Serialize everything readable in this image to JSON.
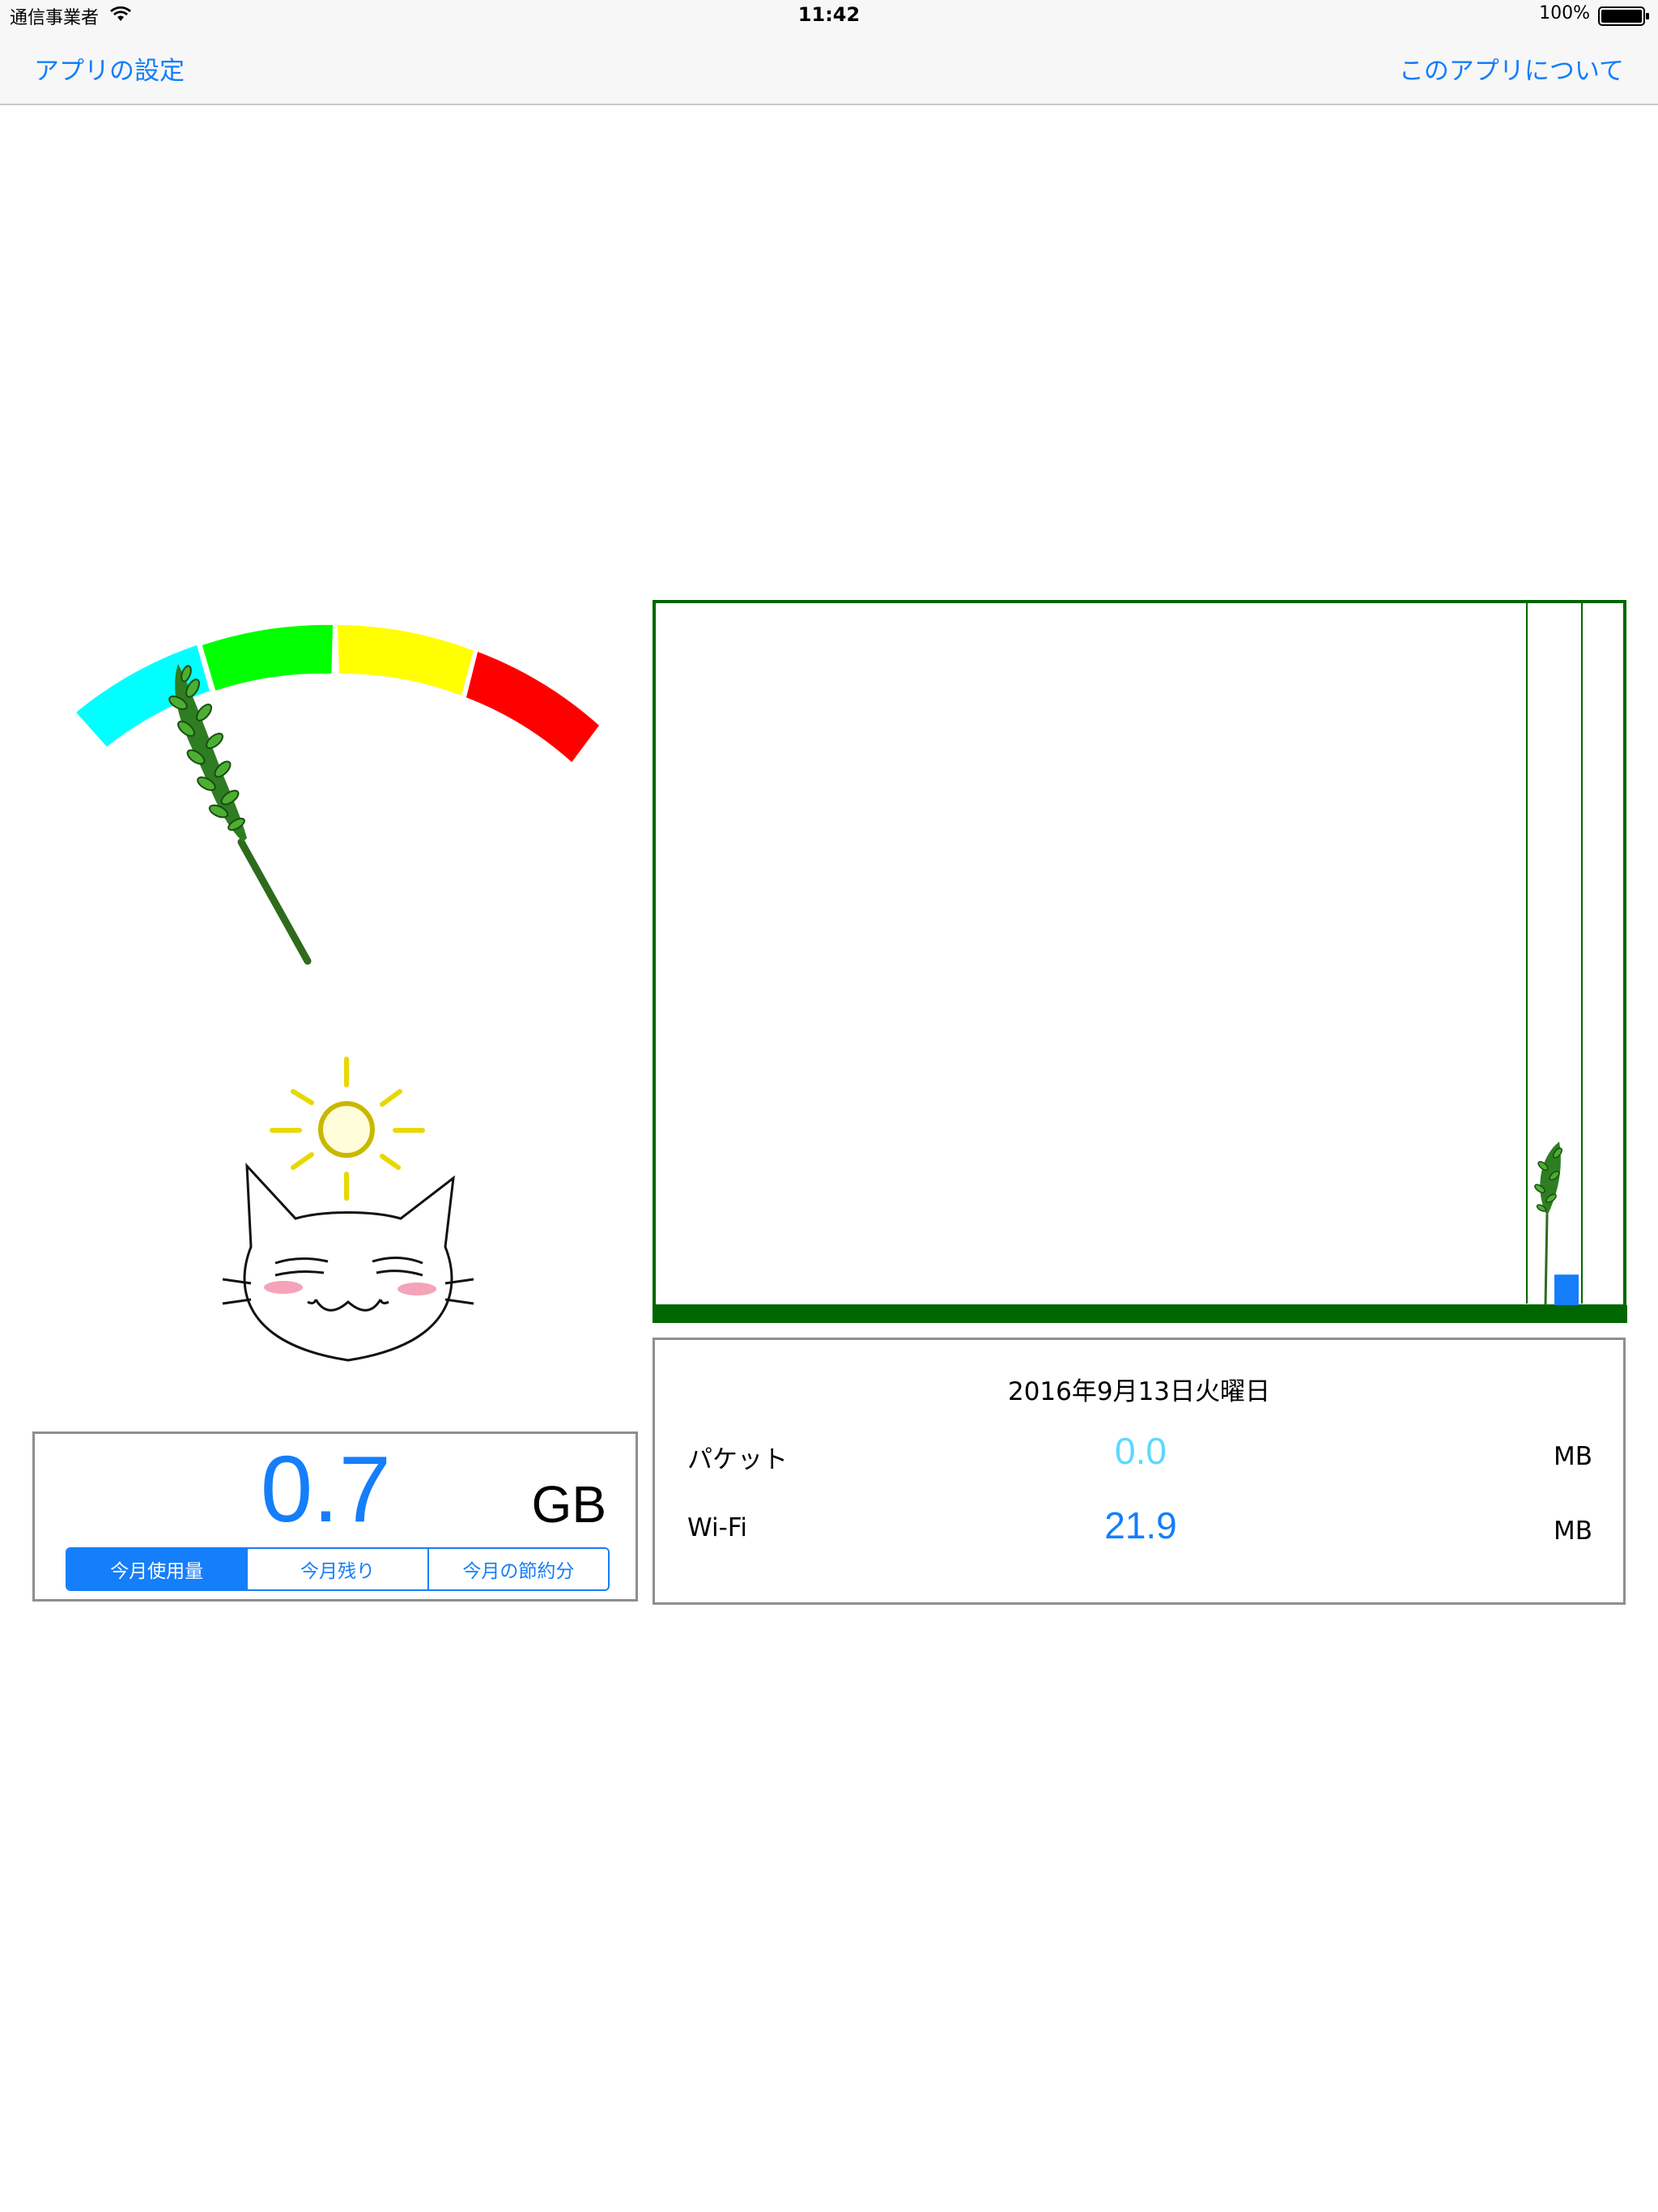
{
  "status_bar": {
    "carrier": "通信事業者",
    "time": "11:42",
    "battery": "100%"
  },
  "nav": {
    "left": "アプリの設定",
    "right": "このアプリについて"
  },
  "usage": {
    "value": "0.7",
    "unit": "GB",
    "segments": [
      "今月使用量",
      "今月残り",
      "今月の節約分"
    ],
    "selected_segment": 0
  },
  "gauge": {
    "bands": [
      "#00ffff",
      "#00ff00",
      "#ffff00",
      "#ff0000"
    ],
    "level": 0.1
  },
  "info": {
    "date": "2016年9月13日火曜日",
    "rows": [
      {
        "label": "パケット",
        "value": "0.0",
        "unit": "MB",
        "color": "#5ad9ff"
      },
      {
        "label": "Wi-Fi",
        "value": "21.9",
        "unit": "MB",
        "color": "#147efb"
      }
    ]
  },
  "chart_data": {
    "type": "bar",
    "categories": [
      ""
    ],
    "values": [
      21.9
    ],
    "ylim": [
      0,
      500
    ],
    "bar_color": "#147efb",
    "border_color": "#006600"
  }
}
